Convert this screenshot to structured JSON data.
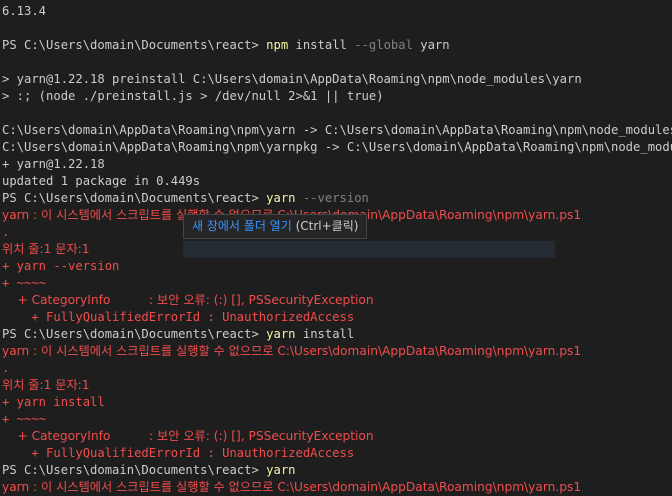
{
  "terminal": {
    "lines": [
      [
        [
          "w",
          "6.13.4"
        ]
      ],
      [],
      [
        [
          "w",
          "PS C:\\Users\\domain\\Documents\\react> "
        ],
        [
          "y",
          "npm"
        ],
        [
          "w",
          " install "
        ],
        [
          "g",
          "--global"
        ],
        [
          "w",
          " yarn"
        ]
      ],
      [],
      [
        [
          "w",
          "> yarn@1.22.18 preinstall C:\\Users\\domain\\AppData\\Roaming\\npm\\node_modules\\yarn"
        ]
      ],
      [
        [
          "w",
          "> :; (node ./preinstall.js > /dev/null 2>&1 || true)"
        ]
      ],
      [],
      [
        [
          "w",
          "C:\\Users\\domain\\AppData\\Roaming\\npm\\yarn -> C:\\Users\\domain\\AppData\\Roaming\\npm\\node_modules\\yarn"
        ]
      ],
      [
        [
          "w",
          "C:\\Users\\domain\\AppData\\Roaming\\npm\\yarnpkg -> C:\\Users\\domain\\AppData\\Roaming\\npm\\node_modules\\yarn"
        ]
      ],
      [
        [
          "w",
          "+ yarn@1.22.18"
        ]
      ],
      [
        [
          "w",
          "updated 1 package in 0.449s"
        ]
      ],
      [
        [
          "w",
          "PS C:\\Users\\domain\\Documents\\react> "
        ],
        [
          "y",
          "yarn"
        ],
        [
          "g",
          " --version"
        ]
      ],
      [
        [
          "r",
          "yarn : 이 시스템에서 스크립트를 실행할 수 없으므로 C:\\Users\\domain\\AppData\\Roaming\\npm\\yarn.ps1"
        ]
      ],
      [
        [
          "r",
          "."
        ]
      ],
      [
        [
          "r",
          "위치 줄:1 문자:1"
        ]
      ],
      [
        [
          "r",
          "+ yarn --version"
        ]
      ],
      [
        [
          "r",
          "+ ~~~~"
        ]
      ],
      [
        [
          "r",
          "    + CategoryInfo          : 보안 오류: (:) [], PSSecurityException"
        ]
      ],
      [
        [
          "r",
          "    + FullyQualifiedErrorId : UnauthorizedAccess"
        ]
      ],
      [
        [
          "w",
          "PS C:\\Users\\domain\\Documents\\react> "
        ],
        [
          "y",
          "yarn"
        ],
        [
          "w",
          " install"
        ]
      ],
      [
        [
          "r",
          "yarn : 이 시스템에서 스크립트를 실행할 수 없으므로 C:\\Users\\domain\\AppData\\Roaming\\npm\\yarn.ps1"
        ]
      ],
      [
        [
          "r",
          "."
        ]
      ],
      [
        [
          "r",
          "위치 줄:1 문자:1"
        ]
      ],
      [
        [
          "r",
          "+ yarn install"
        ]
      ],
      [
        [
          "r",
          "+ ~~~~"
        ]
      ],
      [
        [
          "r",
          "    + CategoryInfo          : 보안 오류: (:) [], PSSecurityException"
        ]
      ],
      [
        [
          "r",
          "    + FullyQualifiedErrorId : UnauthorizedAccess"
        ]
      ],
      [
        [
          "w",
          "PS C:\\Users\\domain\\Documents\\react> "
        ],
        [
          "y",
          "yarn"
        ]
      ],
      [
        [
          "r",
          "yarn : 이 시스템에서 스크립트를 실행할 수 없으므로 C:\\Users\\domain\\AppData\\Roaming\\npm\\yarn.ps1"
        ]
      ]
    ]
  },
  "tooltip": {
    "link_text": "새 장에서 폴더 열기",
    "shortcut": " (Ctrl+클릭)"
  },
  "colors": {
    "background": "#1e1e1e",
    "text": "#cccccc",
    "command": "#f9f1a5",
    "parameter": "#808080",
    "error": "#f14c4c",
    "link": "#3794ff"
  }
}
